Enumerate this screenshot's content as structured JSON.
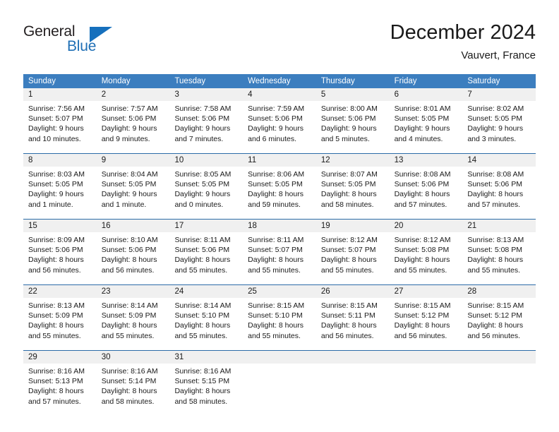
{
  "brand": {
    "name_part1": "General",
    "name_part2": "Blue",
    "accent_color": "#1670bd"
  },
  "header": {
    "title": "December 2024",
    "location": "Vauvert, France"
  },
  "calendar": {
    "header_bg": "#3c7ebf",
    "row_divider": "#2c6ca8",
    "daynum_bg": "#f0f0f0",
    "weekdays": [
      "Sunday",
      "Monday",
      "Tuesday",
      "Wednesday",
      "Thursday",
      "Friday",
      "Saturday"
    ],
    "weeks": [
      {
        "days": [
          {
            "num": "1",
            "sunrise": "Sunrise: 7:56 AM",
            "sunset": "Sunset: 5:07 PM",
            "daylight1": "Daylight: 9 hours",
            "daylight2": "and 10 minutes."
          },
          {
            "num": "2",
            "sunrise": "Sunrise: 7:57 AM",
            "sunset": "Sunset: 5:06 PM",
            "daylight1": "Daylight: 9 hours",
            "daylight2": "and 9 minutes."
          },
          {
            "num": "3",
            "sunrise": "Sunrise: 7:58 AM",
            "sunset": "Sunset: 5:06 PM",
            "daylight1": "Daylight: 9 hours",
            "daylight2": "and 7 minutes."
          },
          {
            "num": "4",
            "sunrise": "Sunrise: 7:59 AM",
            "sunset": "Sunset: 5:06 PM",
            "daylight1": "Daylight: 9 hours",
            "daylight2": "and 6 minutes."
          },
          {
            "num": "5",
            "sunrise": "Sunrise: 8:00 AM",
            "sunset": "Sunset: 5:06 PM",
            "daylight1": "Daylight: 9 hours",
            "daylight2": "and 5 minutes."
          },
          {
            "num": "6",
            "sunrise": "Sunrise: 8:01 AM",
            "sunset": "Sunset: 5:05 PM",
            "daylight1": "Daylight: 9 hours",
            "daylight2": "and 4 minutes."
          },
          {
            "num": "7",
            "sunrise": "Sunrise: 8:02 AM",
            "sunset": "Sunset: 5:05 PM",
            "daylight1": "Daylight: 9 hours",
            "daylight2": "and 3 minutes."
          }
        ]
      },
      {
        "days": [
          {
            "num": "8",
            "sunrise": "Sunrise: 8:03 AM",
            "sunset": "Sunset: 5:05 PM",
            "daylight1": "Daylight: 9 hours",
            "daylight2": "and 1 minute."
          },
          {
            "num": "9",
            "sunrise": "Sunrise: 8:04 AM",
            "sunset": "Sunset: 5:05 PM",
            "daylight1": "Daylight: 9 hours",
            "daylight2": "and 1 minute."
          },
          {
            "num": "10",
            "sunrise": "Sunrise: 8:05 AM",
            "sunset": "Sunset: 5:05 PM",
            "daylight1": "Daylight: 9 hours",
            "daylight2": "and 0 minutes."
          },
          {
            "num": "11",
            "sunrise": "Sunrise: 8:06 AM",
            "sunset": "Sunset: 5:05 PM",
            "daylight1": "Daylight: 8 hours",
            "daylight2": "and 59 minutes."
          },
          {
            "num": "12",
            "sunrise": "Sunrise: 8:07 AM",
            "sunset": "Sunset: 5:05 PM",
            "daylight1": "Daylight: 8 hours",
            "daylight2": "and 58 minutes."
          },
          {
            "num": "13",
            "sunrise": "Sunrise: 8:08 AM",
            "sunset": "Sunset: 5:06 PM",
            "daylight1": "Daylight: 8 hours",
            "daylight2": "and 57 minutes."
          },
          {
            "num": "14",
            "sunrise": "Sunrise: 8:08 AM",
            "sunset": "Sunset: 5:06 PM",
            "daylight1": "Daylight: 8 hours",
            "daylight2": "and 57 minutes."
          }
        ]
      },
      {
        "days": [
          {
            "num": "15",
            "sunrise": "Sunrise: 8:09 AM",
            "sunset": "Sunset: 5:06 PM",
            "daylight1": "Daylight: 8 hours",
            "daylight2": "and 56 minutes."
          },
          {
            "num": "16",
            "sunrise": "Sunrise: 8:10 AM",
            "sunset": "Sunset: 5:06 PM",
            "daylight1": "Daylight: 8 hours",
            "daylight2": "and 56 minutes."
          },
          {
            "num": "17",
            "sunrise": "Sunrise: 8:11 AM",
            "sunset": "Sunset: 5:06 PM",
            "daylight1": "Daylight: 8 hours",
            "daylight2": "and 55 minutes."
          },
          {
            "num": "18",
            "sunrise": "Sunrise: 8:11 AM",
            "sunset": "Sunset: 5:07 PM",
            "daylight1": "Daylight: 8 hours",
            "daylight2": "and 55 minutes."
          },
          {
            "num": "19",
            "sunrise": "Sunrise: 8:12 AM",
            "sunset": "Sunset: 5:07 PM",
            "daylight1": "Daylight: 8 hours",
            "daylight2": "and 55 minutes."
          },
          {
            "num": "20",
            "sunrise": "Sunrise: 8:12 AM",
            "sunset": "Sunset: 5:08 PM",
            "daylight1": "Daylight: 8 hours",
            "daylight2": "and 55 minutes."
          },
          {
            "num": "21",
            "sunrise": "Sunrise: 8:13 AM",
            "sunset": "Sunset: 5:08 PM",
            "daylight1": "Daylight: 8 hours",
            "daylight2": "and 55 minutes."
          }
        ]
      },
      {
        "days": [
          {
            "num": "22",
            "sunrise": "Sunrise: 8:13 AM",
            "sunset": "Sunset: 5:09 PM",
            "daylight1": "Daylight: 8 hours",
            "daylight2": "and 55 minutes."
          },
          {
            "num": "23",
            "sunrise": "Sunrise: 8:14 AM",
            "sunset": "Sunset: 5:09 PM",
            "daylight1": "Daylight: 8 hours",
            "daylight2": "and 55 minutes."
          },
          {
            "num": "24",
            "sunrise": "Sunrise: 8:14 AM",
            "sunset": "Sunset: 5:10 PM",
            "daylight1": "Daylight: 8 hours",
            "daylight2": "and 55 minutes."
          },
          {
            "num": "25",
            "sunrise": "Sunrise: 8:15 AM",
            "sunset": "Sunset: 5:10 PM",
            "daylight1": "Daylight: 8 hours",
            "daylight2": "and 55 minutes."
          },
          {
            "num": "26",
            "sunrise": "Sunrise: 8:15 AM",
            "sunset": "Sunset: 5:11 PM",
            "daylight1": "Daylight: 8 hours",
            "daylight2": "and 56 minutes."
          },
          {
            "num": "27",
            "sunrise": "Sunrise: 8:15 AM",
            "sunset": "Sunset: 5:12 PM",
            "daylight1": "Daylight: 8 hours",
            "daylight2": "and 56 minutes."
          },
          {
            "num": "28",
            "sunrise": "Sunrise: 8:15 AM",
            "sunset": "Sunset: 5:12 PM",
            "daylight1": "Daylight: 8 hours",
            "daylight2": "and 56 minutes."
          }
        ]
      },
      {
        "days": [
          {
            "num": "29",
            "sunrise": "Sunrise: 8:16 AM",
            "sunset": "Sunset: 5:13 PM",
            "daylight1": "Daylight: 8 hours",
            "daylight2": "and 57 minutes."
          },
          {
            "num": "30",
            "sunrise": "Sunrise: 8:16 AM",
            "sunset": "Sunset: 5:14 PM",
            "daylight1": "Daylight: 8 hours",
            "daylight2": "and 58 minutes."
          },
          {
            "num": "31",
            "sunrise": "Sunrise: 8:16 AM",
            "sunset": "Sunset: 5:15 PM",
            "daylight1": "Daylight: 8 hours",
            "daylight2": "and 58 minutes."
          },
          {
            "num": "",
            "sunrise": "",
            "sunset": "",
            "daylight1": "",
            "daylight2": ""
          },
          {
            "num": "",
            "sunrise": "",
            "sunset": "",
            "daylight1": "",
            "daylight2": ""
          },
          {
            "num": "",
            "sunrise": "",
            "sunset": "",
            "daylight1": "",
            "daylight2": ""
          },
          {
            "num": "",
            "sunrise": "",
            "sunset": "",
            "daylight1": "",
            "daylight2": ""
          }
        ]
      }
    ]
  }
}
